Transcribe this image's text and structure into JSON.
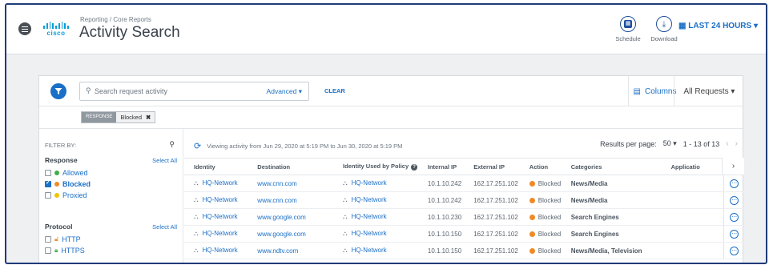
{
  "header": {
    "breadcrumb": "Reporting / Core Reports",
    "title": "Activity Search",
    "logo_text": "cisco",
    "actions": [
      {
        "label": "Schedule",
        "icon": "calendar-icon"
      },
      {
        "label": "Download",
        "icon": "download-icon"
      }
    ],
    "time_range": "LAST 24 HOURS"
  },
  "toolbar": {
    "search_placeholder": "Search request activity",
    "advanced_label": "Advanced",
    "clear_label": "CLEAR",
    "columns_label": "Columns",
    "requests_select": "All Requests"
  },
  "active_filter": {
    "key": "RESPONSE",
    "value": "Blocked"
  },
  "filter_panel": {
    "title": "FILTER BY:",
    "groups": [
      {
        "title": "Response",
        "select_all": "Select All",
        "options": [
          {
            "label": "Allowed",
            "checked": false,
            "color": "#3fae49"
          },
          {
            "label": "Blocked",
            "checked": true,
            "color": "#f08a24"
          },
          {
            "label": "Proxied",
            "checked": false,
            "color": "#f2c400"
          }
        ]
      },
      {
        "title": "Protocol",
        "select_all": "Select All",
        "options": [
          {
            "label": "HTTP",
            "checked": false,
            "icon": "unlock-icon"
          },
          {
            "label": "HTTPS",
            "checked": false,
            "icon": "lock-icon"
          }
        ]
      }
    ]
  },
  "results": {
    "viewing_text": "Viewing activity from Jun 29, 2020 at 5:19 PM to Jun 30, 2020 at 5:19 PM",
    "results_per_page_label": "Results per page:",
    "results_per_page": "50",
    "range_text": "1 - 13 of 13",
    "columns": [
      "Identity",
      "Destination",
      "Identity Used by Policy",
      "Internal IP",
      "External IP",
      "Action",
      "Categories",
      "Applicatio"
    ],
    "rows": [
      {
        "identity": "HQ-Network",
        "destination": "www.cnn.com",
        "policy_identity": "HQ-Network",
        "internal_ip": "10.1.10.242",
        "external_ip": "162.17.251.102",
        "action": "Blocked",
        "categories": "News/Media"
      },
      {
        "identity": "HQ-Network",
        "destination": "www.cnn.com",
        "policy_identity": "HQ-Network",
        "internal_ip": "10.1.10.242",
        "external_ip": "162.17.251.102",
        "action": "Blocked",
        "categories": "News/Media"
      },
      {
        "identity": "HQ-Network",
        "destination": "www.google.com",
        "policy_identity": "HQ-Network",
        "internal_ip": "10.1.10.230",
        "external_ip": "162.17.251.102",
        "action": "Blocked",
        "categories": "Search Engines"
      },
      {
        "identity": "HQ-Network",
        "destination": "www.google.com",
        "policy_identity": "HQ-Network",
        "internal_ip": "10.1.10.150",
        "external_ip": "162.17.251.102",
        "action": "Blocked",
        "categories": "Search Engines"
      },
      {
        "identity": "HQ-Network",
        "destination": "www.ndtv.com",
        "policy_identity": "HQ-Network",
        "internal_ip": "10.1.10.150",
        "external_ip": "162.17.251.102",
        "action": "Blocked",
        "categories": "News/Media, Television"
      }
    ]
  },
  "colors": {
    "accent": "#1a6fc7",
    "frame_border": "#1f3b7a",
    "blocked": "#f08a24"
  }
}
